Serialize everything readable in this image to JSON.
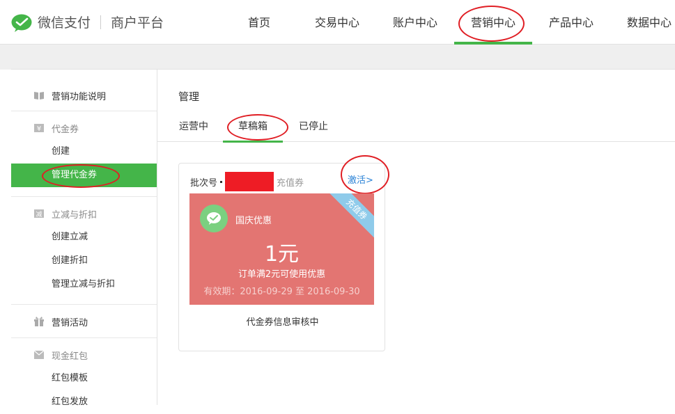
{
  "brand": {
    "product": "微信支付",
    "platform": "商户平台",
    "accent_color": "#44b549"
  },
  "nav": {
    "items": [
      {
        "label": "首页"
      },
      {
        "label": "交易中心"
      },
      {
        "label": "账户中心"
      },
      {
        "label": "营销中心",
        "active": true
      },
      {
        "label": "产品中心"
      },
      {
        "label": "数据中心"
      }
    ]
  },
  "sidebar": {
    "groups": [
      {
        "icon": "book-icon",
        "label": "营销功能说明",
        "items": []
      },
      {
        "icon": "yen-icon",
        "label": "代金券",
        "items": [
          {
            "label": "创建"
          },
          {
            "label": "管理代金券",
            "active": true
          }
        ]
      },
      {
        "icon": "minus-badge-icon",
        "label": "立减与折扣",
        "items": [
          {
            "label": "创建立减"
          },
          {
            "label": "创建折扣"
          },
          {
            "label": "管理立减与折扣"
          }
        ]
      },
      {
        "icon": "gift-icon",
        "label": "营销活动",
        "items": []
      },
      {
        "icon": "red-packet-icon",
        "label": "现金红包",
        "items": [
          {
            "label": "红包模板"
          },
          {
            "label": "红包发放"
          }
        ]
      }
    ]
  },
  "main": {
    "title": "管理",
    "tabs": [
      {
        "label": "运营中"
      },
      {
        "label": "草稿箱",
        "active": true
      },
      {
        "label": "已停止"
      }
    ]
  },
  "card": {
    "batch_label": "批次号",
    "type_label": "充值券",
    "activate_label": "激活>",
    "coupon": {
      "name": "国庆优惠",
      "value": "1元",
      "condition": "订单满2元可使用优惠",
      "validity": "有效期：2016-09-29 至 2016-09-30",
      "ribbon": "充值券",
      "bg_color": "#e37572",
      "ribbon_color": "#8fcbea"
    },
    "status": "代金券信息审核中"
  }
}
